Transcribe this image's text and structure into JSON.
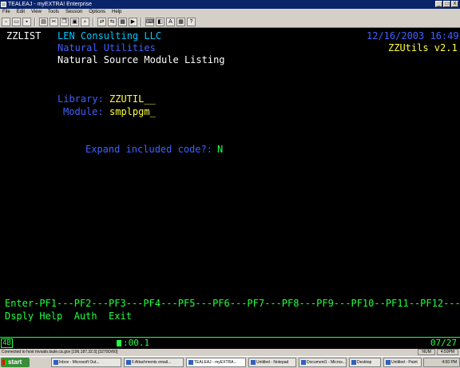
{
  "window": {
    "title": "TEALEAJ - myEXTRA! Enterprise",
    "buttons": [
      "_",
      "□",
      "X"
    ]
  },
  "menu": [
    "File",
    "Edit",
    "View",
    "Tools",
    "Session",
    "Options",
    "Help"
  ],
  "terminal": {
    "program_id": "ZZLIST",
    "company": "LEN Consulting LLC",
    "datetime": "12/16/2003 16:49",
    "subtitle1": "Natural Utilities",
    "version": "ZZUtils v2.1",
    "subtitle2": "Natural Source Module Listing",
    "library_label": "Library:",
    "library_value": "ZZUTIL__",
    "module_label": "Module:",
    "module_value": "smplpgm_",
    "expand_label": "Expand included code?:",
    "expand_value": "N",
    "pf_line": "Enter-PF1---PF2---PF3---PF4---PF5---PF6---PF7---PF8---PF9---PF10--PF11--PF12---",
    "pf_labels": "Dsply Help  Auth  Exit"
  },
  "oia": {
    "indicator": "4B",
    "timer": ":00.1",
    "cursor_pos": "07/27"
  },
  "statusbar": {
    "connection": "Connected to host mvsato.tsule.ca.gov [196.187.32.5] [3270D/60]",
    "cells": [
      "NUM",
      "4:50PM"
    ]
  },
  "taskbar": {
    "start_label": "start",
    "tasks": [
      "Inbox - Microsoft Out...",
      "6 Attachments email...",
      "TEALEAJ - myEXTRA...",
      "Untitled - Notepad",
      "Document1 - Micros...",
      "Desktop",
      "Untitled - Paint"
    ],
    "clock": "4:50 PM"
  }
}
